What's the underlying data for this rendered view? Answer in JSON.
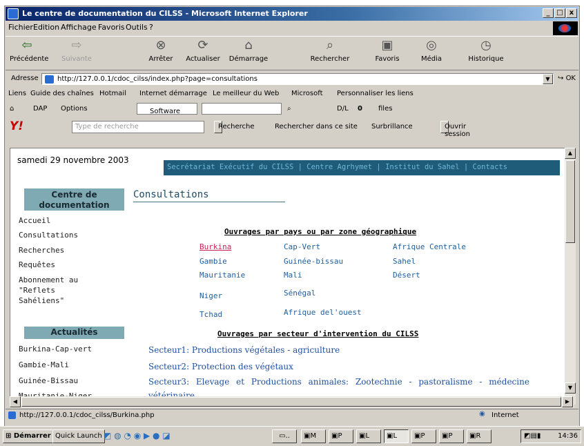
{
  "window": {
    "title": "Le centre de documentation du CILSS - Microsoft Internet Explorer"
  },
  "menu": [
    "Fichier",
    "Edition",
    "Affichage",
    "Favoris",
    "Outils",
    "?"
  ],
  "toolbar": [
    {
      "label": "Précédente",
      "icon": "back-arrow-icon"
    },
    {
      "label": "Suivante",
      "icon": "forward-arrow-icon"
    },
    {
      "label": "Arrêter",
      "icon": "stop-icon"
    },
    {
      "label": "Actualiser",
      "icon": "refresh-icon"
    },
    {
      "label": "Démarrage",
      "icon": "home-icon"
    },
    {
      "label": "Rechercher",
      "icon": "search-icon"
    },
    {
      "label": "Favoris",
      "icon": "favorites-icon"
    },
    {
      "label": "Média",
      "icon": "media-icon"
    },
    {
      "label": "Historique",
      "icon": "history-icon"
    }
  ],
  "address": {
    "label": "Adresse",
    "url": "http://127.0.0.1/cdoc_cilss/index.php?page=consultations",
    "go": "OK"
  },
  "links_bar": {
    "label": "Liens",
    "items": [
      "Guide des chaînes",
      "Hotmail",
      "Internet démarrage",
      "Le meilleur du Web",
      "Microsoft",
      "Personnaliser les liens"
    ]
  },
  "dap_bar": {
    "dap": "DAP",
    "options": "Options",
    "software": "Software",
    "dl": "D/L",
    "dl_count": "0",
    "files": "files"
  },
  "yahoo_bar": {
    "placeholder": "Type de recherche",
    "search_button": "Recherche",
    "site_search": "Rechercher dans ce site",
    "highlight": "Surbrillance",
    "open_session": "Ouvrir session"
  },
  "page": {
    "date": "samedi 29 novembre 2003",
    "top_links": "Secrétariat Exécutif du CILSS | Centre Agrhymet | Institut du Sahel | Contacts",
    "title": "Consultations",
    "sidebar": {
      "section1_title_line1": "Centre de",
      "section1_title_line2": "documentation",
      "section1_links": [
        "Accueil",
        "Consultations",
        "Recherches",
        "Requêtes",
        "Abonnement au",
        "\"Reflets",
        "Sahéliens\""
      ],
      "section2_title": "Actualités",
      "section2_links": [
        "Burkina-Cap-vert",
        "Gambie-Mali",
        "Guinée-Bissau",
        "Mauritanie-Niger"
      ]
    },
    "countries_heading": "Ouvrages par pays ou par zone géographique",
    "countries": [
      [
        "Burkina",
        "Cap-Vert",
        "Afrique Centrale"
      ],
      [
        "Gambie",
        "Guinée-bissau",
        "Sahel"
      ],
      [
        "Mauritanie",
        "Mali",
        "Désert"
      ],
      [
        "Niger",
        "Sénégal",
        ""
      ],
      [
        "Tchad",
        "Afrique del'ouest",
        ""
      ]
    ],
    "sectors_heading": "Ouvrages par secteur d'intervention du CILSS",
    "sectors": [
      "Secteur1: Productions végétales - agriculture",
      "Secteur2: Protection des végétaux",
      "Secteur3: Elevage et Productions animales: Zootechnie - pastoralisme - médecine",
      "vétérinaire"
    ]
  },
  "status_bar": {
    "url": "http://127.0.0.1/cdoc_cilss/Burkina.php",
    "zone": "Internet"
  },
  "taskbar": {
    "start": "Démarrer",
    "quick_launch": "Quick Launch",
    "clock": "14:36",
    "tasks": [
      "M",
      "P",
      "L",
      "L",
      "P",
      "P",
      "R"
    ]
  },
  "colors": {
    "titlebar": "#0a246a",
    "link_blue": "#1f5e9e",
    "visited_red": "#cc2255",
    "sidebar_head": "#7fa9b3",
    "top_bar": "#1f5c7a"
  }
}
